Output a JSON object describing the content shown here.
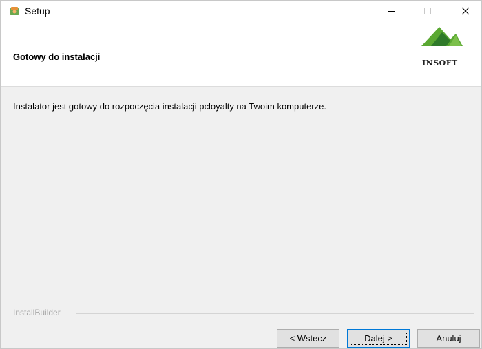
{
  "window": {
    "title": "Setup",
    "controls": {
      "minimize": "—",
      "maximize": "□",
      "close": "✕"
    }
  },
  "header": {
    "title": "Gotowy do instalacji",
    "logo_text": "INSOFT"
  },
  "body": {
    "message": "Instalator jest gotowy do rozpoczęcia instalacji pcloyalty na Twoim komputerze."
  },
  "footer": {
    "branding": "InstallBuilder",
    "buttons": {
      "back": "< Wstecz",
      "next": "Dalej >",
      "cancel": "Anuluj"
    }
  },
  "colors": {
    "logo_green": "#5aa832",
    "logo_dark_green": "#2f7a2a"
  },
  "icons": {
    "app": "setup-app-icon",
    "logo": "insoft-mountain-logo"
  }
}
